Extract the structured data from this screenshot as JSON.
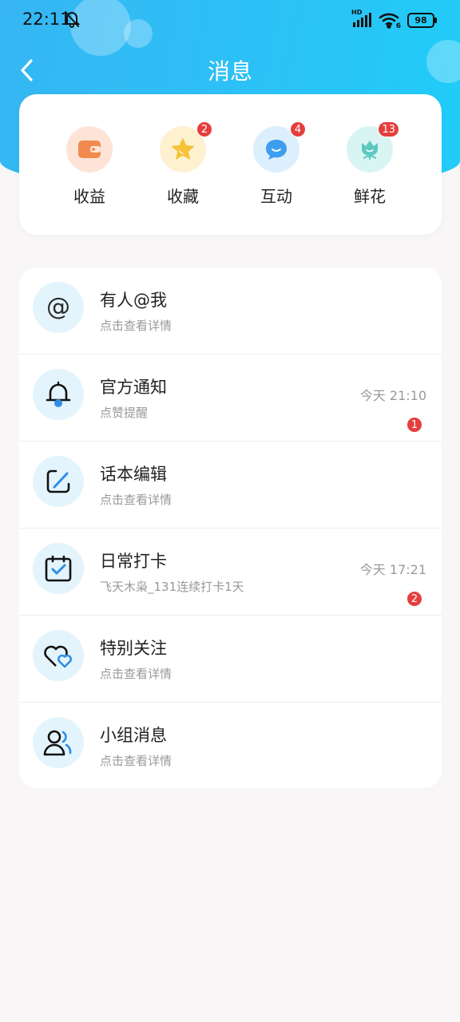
{
  "status_bar": {
    "time": "22:11",
    "battery": "98",
    "hd_label": "HD",
    "signal_sub": "6"
  },
  "header": {
    "title": "消息"
  },
  "quick_actions": [
    {
      "label": "收益",
      "icon": "wallet-icon",
      "badge": null,
      "bg": "#fde4d6",
      "color": "#f28a4f"
    },
    {
      "label": "收藏",
      "icon": "star-icon",
      "badge": "2",
      "bg": "#fdf1cf",
      "color": "#f6c338"
    },
    {
      "label": "互动",
      "icon": "chat-bubble-icon",
      "badge": "4",
      "bg": "#dbeffd",
      "color": "#3d9ef0"
    },
    {
      "label": "鲜花",
      "icon": "flower-icon",
      "badge": "13",
      "bg": "#d9f5f3",
      "color": "#5cc9c1"
    }
  ],
  "messages": [
    {
      "title": "有人@我",
      "subtitle": "点击查看详情",
      "time": "",
      "badge": null,
      "icon": "at-icon"
    },
    {
      "title": "官方通知",
      "subtitle": "点赞提醒",
      "time": "今天 21:10",
      "badge": "1",
      "icon": "bell-icon"
    },
    {
      "title": "话本编辑",
      "subtitle": "点击查看详情",
      "time": "",
      "badge": null,
      "icon": "edit-icon"
    },
    {
      "title": "日常打卡",
      "subtitle": "飞天木枭_131连续打卡1天",
      "time": "今天 17:21",
      "badge": "2",
      "icon": "calendar-check-icon"
    },
    {
      "title": "特别关注",
      "subtitle": "点击查看详情",
      "time": "",
      "badge": null,
      "icon": "hearts-icon"
    },
    {
      "title": "小组消息",
      "subtitle": "点击查看详情",
      "time": "",
      "badge": null,
      "icon": "group-icon"
    }
  ],
  "colors": {
    "header_start": "#36b6f3",
    "header_end": "#20cdf8",
    "badge": "#e53e3e",
    "accent_blue": "#2e8ee6"
  }
}
